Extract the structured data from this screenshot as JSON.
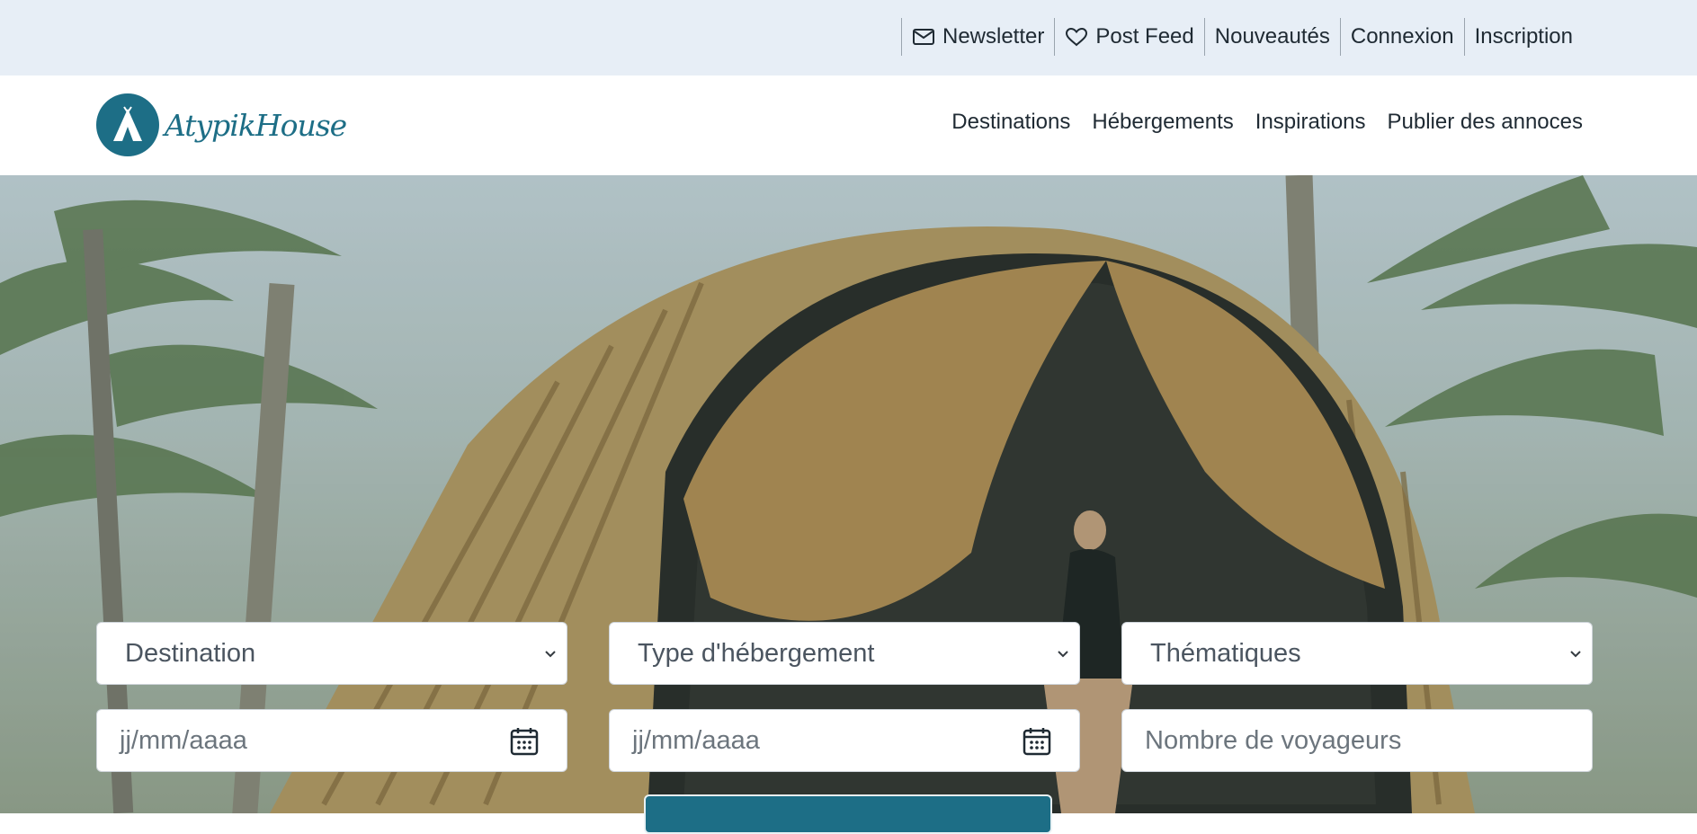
{
  "topbar": {
    "links": [
      {
        "label": "Newsletter",
        "icon": "envelope-icon"
      },
      {
        "label": "Post Feed",
        "icon": "heart-icon"
      },
      {
        "label": "Nouveautés"
      },
      {
        "label": "Connexion"
      },
      {
        "label": "Inscription"
      }
    ]
  },
  "header": {
    "logo_text": "AtypikHouse",
    "nav": [
      "Destinations",
      "Hébergements",
      "Inspirations",
      "Publier des annoces"
    ]
  },
  "search": {
    "destination": "Destination",
    "type": "Type d'hébergement",
    "thematiques": "Thématiques",
    "date_start_placeholder": "jj/mm/aaaa",
    "date_end_placeholder": "jj/mm/aaaa",
    "travelers_placeholder": "Nombre de voyageurs"
  },
  "colors": {
    "brand": "#1d6e86",
    "topbar_bg": "#e7eef6"
  }
}
